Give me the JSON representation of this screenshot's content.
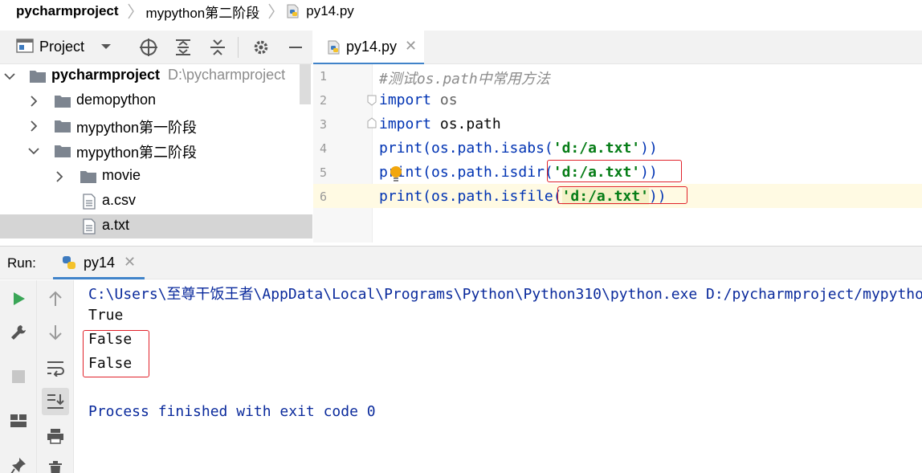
{
  "breadcrumb": {
    "items": [
      "pycharmproject",
      "mypython第二阶段",
      "py14.py"
    ]
  },
  "project_panel": {
    "title": "Project",
    "tree": [
      {
        "label": "pycharmproject",
        "path": "D:\\pycharmproject",
        "kind": "root-folder",
        "expanded": true
      },
      {
        "label": "demopython",
        "kind": "folder",
        "expanded": false
      },
      {
        "label": "mypython第一阶段",
        "kind": "folder",
        "expanded": false
      },
      {
        "label": "mypython第二阶段",
        "kind": "folder",
        "expanded": true
      },
      {
        "label": "movie",
        "kind": "folder",
        "expanded": false
      },
      {
        "label": "a.csv",
        "kind": "file"
      },
      {
        "label": "a.txt",
        "kind": "file",
        "selected": true
      }
    ]
  },
  "editor": {
    "tab_label": "py14.py",
    "line_numbers": [
      "1",
      "2",
      "3",
      "4",
      "5",
      "6"
    ],
    "lines": {
      "l1": "#测试os.path中常用方法",
      "l2_kw": "import",
      "l2_rest": " os",
      "l3_kw": "import",
      "l3_rest": " os.path",
      "l4_fn": "print(os.path.isabs(",
      "l4_str": "'d:/a.txt'",
      "l4_end": "))",
      "l5_fn": "print(os.path.isdir(",
      "l5_str": "'d:/a.txt'",
      "l5_end": "))",
      "l6_fn": "print(os.path.isfile(",
      "l6_str": "'d:/a.txt'",
      "l6_end": "))"
    }
  },
  "run_panel": {
    "label": "Run:",
    "tab_label": "py14",
    "console": {
      "command": "C:\\Users\\至尊干饭王者\\AppData\\Local\\Programs\\Python\\Python310\\python.exe D:/pycharmproject/mypython",
      "outputs": [
        "True",
        "False",
        "False"
      ],
      "exit_message": "Process finished with exit code 0"
    }
  },
  "colors": {
    "keyword": "#0033b3",
    "string": "#067d17",
    "comment": "#8c8c8c",
    "highlight_box": "#e0222a",
    "accent": "#4083c9"
  }
}
